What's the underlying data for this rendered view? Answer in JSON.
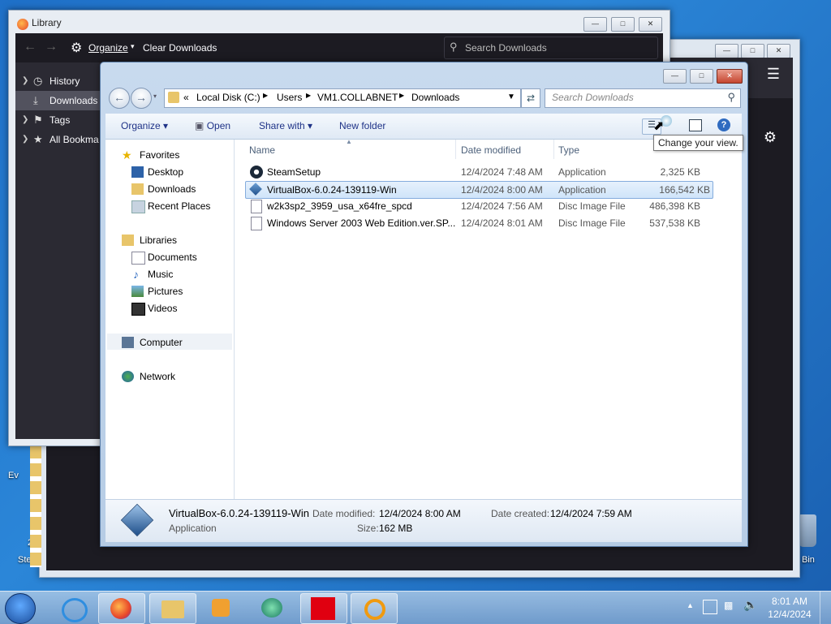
{
  "desktop": {
    "left_labels": [
      "Ev",
      "21",
      "Stea"
    ],
    "recycle_label": "Bin"
  },
  "library": {
    "title": "Library",
    "organize_label": "Organize",
    "clear_downloads_label": "Clear Downloads",
    "search_placeholder": "Search Downloads",
    "sidebar": [
      {
        "label": "History",
        "icon": "clock-icon"
      },
      {
        "label": "Downloads",
        "icon": "download-icon"
      },
      {
        "label": "Tags",
        "icon": "tag-icon"
      },
      {
        "label": "All Bookma",
        "icon": "star-icon"
      }
    ]
  },
  "explorer": {
    "breadcrumb": [
      "Local Disk (C:)",
      "Users",
      "VM1.COLLABNET",
      "Downloads"
    ],
    "search_placeholder": "Search Downloads",
    "commands": {
      "organize": "Organize",
      "open": "Open",
      "share_with": "Share with",
      "new_folder": "New folder"
    },
    "tooltip": "Change your view.",
    "nav": {
      "favorites": "Favorites",
      "desktop": "Desktop",
      "downloads": "Downloads",
      "recent": "Recent Places",
      "libraries": "Libraries",
      "documents": "Documents",
      "music": "Music",
      "pictures": "Pictures",
      "videos": "Videos",
      "computer": "Computer",
      "network": "Network"
    },
    "columns": {
      "name": "Name",
      "date": "Date modified",
      "type": "Type"
    },
    "files": [
      {
        "name": "SteamSetup",
        "date": "12/4/2024 7:48 AM",
        "type": "Application",
        "size": "2,325 KB"
      },
      {
        "name": "VirtualBox-6.0.24-139119-Win",
        "date": "12/4/2024 8:00 AM",
        "type": "Application",
        "size": "166,542 KB"
      },
      {
        "name": "w2k3sp2_3959_usa_x64fre_spcd",
        "date": "12/4/2024 7:56 AM",
        "type": "Disc Image File",
        "size": "486,398 KB"
      },
      {
        "name": "Windows Server 2003 Web Edition.ver.SP...",
        "date": "12/4/2024 8:01 AM",
        "type": "Disc Image File",
        "size": "537,538 KB"
      }
    ],
    "details": {
      "name": "VirtualBox-6.0.24-139119-Win",
      "type": "Application",
      "date_modified_label": "Date modified:",
      "date_modified": "12/4/2024 8:00 AM",
      "date_created_label": "Date created:",
      "date_created": "12/4/2024 7:59 AM",
      "size_label": "Size:",
      "size": "162 MB"
    }
  },
  "taskbar": {
    "time": "8:01 AM",
    "date": "12/4/2024"
  }
}
